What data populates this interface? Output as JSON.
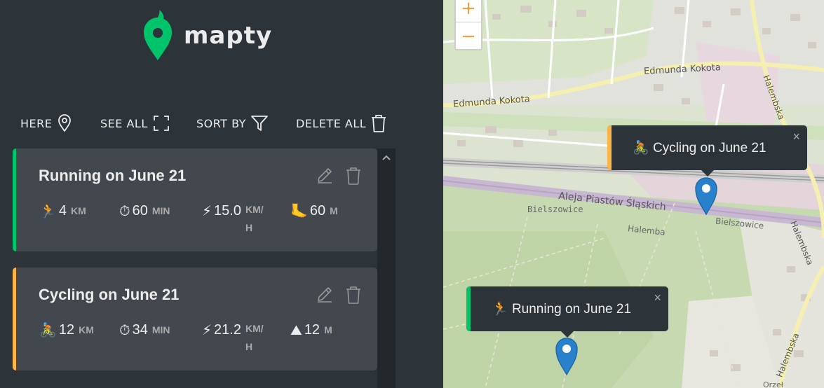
{
  "app": {
    "name": "mapty"
  },
  "controls": {
    "here": "HERE",
    "see_all": "SEE ALL",
    "sort_by": "SORT BY",
    "delete_all": "DELETE ALL"
  },
  "workouts": [
    {
      "type": "running",
      "accent": "#00c46a",
      "title": "Running on June 21",
      "icon": "🏃",
      "distance": "4",
      "distance_unit": "KM",
      "duration": "60",
      "duration_unit": "MIN",
      "speed": "15.0",
      "speed_unit": "KM/H",
      "extra_icon": "🦶",
      "extra": "60",
      "extra_unit": "M"
    },
    {
      "type": "cycling",
      "accent": "#ffb545",
      "title": "Cycling on June 21",
      "icon": "🚴",
      "distance": "12",
      "distance_unit": "KM",
      "duration": "34",
      "duration_unit": "MIN",
      "speed": "21.2",
      "speed_unit": "KM/H",
      "extra_icon": "⛰",
      "extra": "12",
      "extra_unit": "M"
    }
  ],
  "map": {
    "zoom_in": "+",
    "zoom_out": "−",
    "labels": {
      "street1": "Edmunda Kokota",
      "street2": "Edmunda Kokota",
      "street3": "Halembska",
      "street4": "Aleja Piastów Śląskich",
      "place1": "Bielszowice",
      "place2": "Bielszowice",
      "place3": "Halemba",
      "street5": "Halembska",
      "street6": "Halembska",
      "place4": "Orzeł"
    },
    "popups": [
      {
        "icon": "🚴",
        "text": "Cycling on June 21",
        "accent": "#ffb545"
      },
      {
        "icon": "🏃",
        "text": "Running on June 21",
        "accent": "#00c46a"
      }
    ],
    "close_symbol": "×"
  }
}
